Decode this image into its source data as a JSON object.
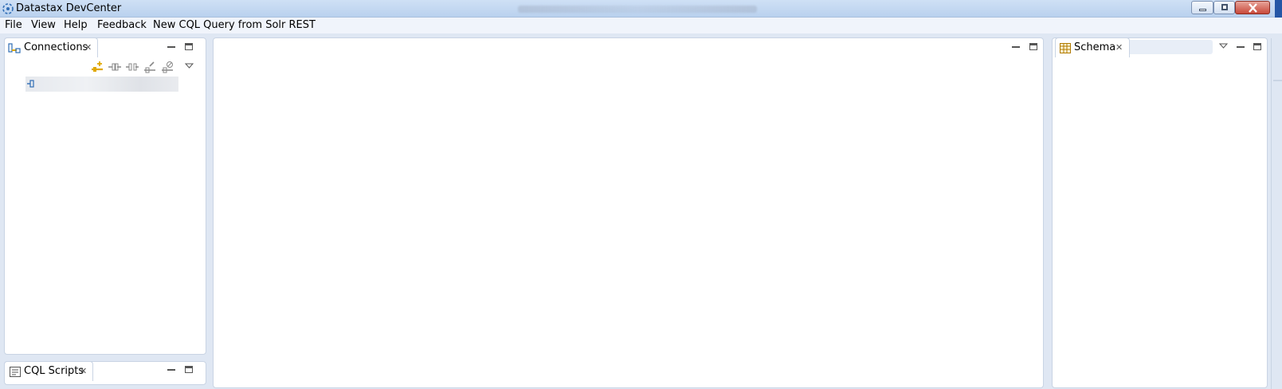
{
  "window": {
    "title": "Datastax DevCenter"
  },
  "menu": {
    "items": [
      "File",
      "View",
      "Help",
      "Feedback",
      "New CQL Query from Solr REST"
    ]
  },
  "connections_view": {
    "tab_label": "Connections",
    "toolbar_icons": [
      "new-connection-icon",
      "connect-icon",
      "disconnect-icon",
      "edit-connection-icon",
      "delete-connection-icon"
    ]
  },
  "cql_scripts_view": {
    "tab_label": "CQL Scripts"
  },
  "schema_view": {
    "tab_label": "Schema"
  },
  "colors": {
    "background": "#dfe7f3",
    "titlebar": "#b9d1ee",
    "panel_border": "#c9d4e4",
    "icon_yellow": "#e0a800",
    "icon_blue": "#2f6db5"
  }
}
